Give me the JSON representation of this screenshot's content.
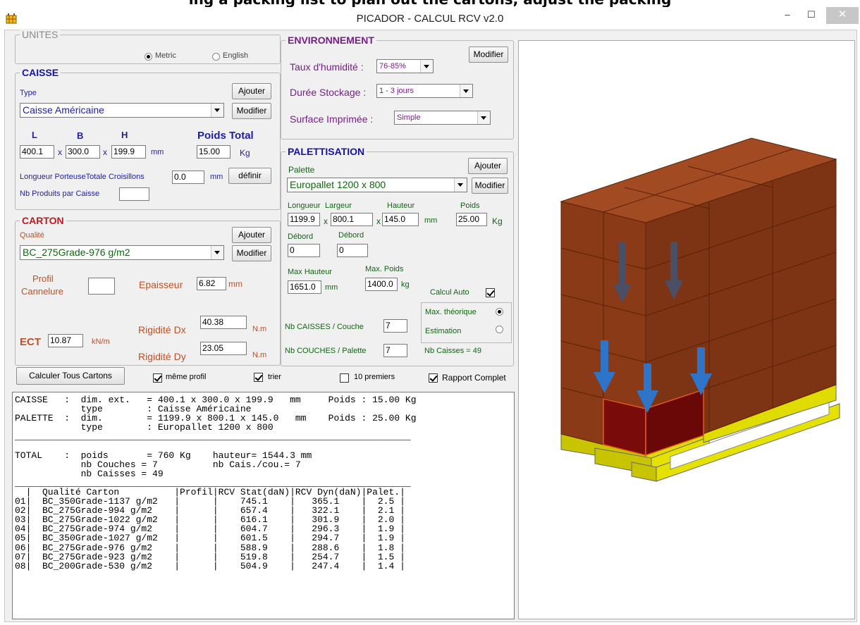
{
  "banner_text": "ing a packing list to plan out the cartons, adjust the packing",
  "window": {
    "title": "PICADOR - CALCUL RCV  v2.0",
    "min": "–",
    "max": "☐",
    "close": "✕"
  },
  "unites": {
    "title": "UNITES",
    "metric": "Metric",
    "english": "English",
    "selected": "metric"
  },
  "caisse": {
    "title": "CAISSE",
    "type_label": "Type",
    "type_value": "Caisse Américaine",
    "add": "Ajouter",
    "modify": "Modifier",
    "L": "L",
    "B": "B",
    "H": "H",
    "poids_total": "Poids Total",
    "L_val": "400.1",
    "B_val": "300.0",
    "H_val": "199.9",
    "x": "x",
    "mm": "mm",
    "poids_val": "15.00",
    "kg": "Kg",
    "croisillons_label": "Longueur PorteuseTotale Croisillons",
    "croisillons_val": "0.0",
    "croisillons_mm": "mm",
    "definir": "définir",
    "nb_produits_label": "Nb Produits par Caisse",
    "nb_produits_val": ""
  },
  "carton": {
    "title": "CARTON",
    "qualite_label": "Qualité",
    "qualite_value": "BC_275Grade-976 g/m2",
    "add": "Ajouter",
    "modify": "Modifier",
    "profil_label1": "Profil",
    "profil_label2": "Cannelure",
    "profil_val": "",
    "epaisseur_label": "Epaisseur",
    "epaisseur_val": "6.82",
    "epaisseur_unit": "mm",
    "ect_label": "ECT",
    "ect_val": "10.87",
    "ect_unit": "kN/m",
    "rig_dx_label": "Rigidité Dx",
    "rig_dx_val": "40.38",
    "rig_dy_label": "Rigidité Dy",
    "rig_dy_val": "23.05",
    "nm": "N.m"
  },
  "environnement": {
    "title": "ENVIRONNEMENT",
    "modify": "Modifier",
    "humidite_label": "Taux d'humidité :",
    "humidite_val": "76-85%",
    "duree_label": "Durée Stockage :",
    "duree_val": "1 - 3 jours",
    "surface_label": "Surface Imprimée :",
    "surface_val": "Simple"
  },
  "palettisation": {
    "title": "PALETTISATION",
    "palette_label": "Palette",
    "palette_value": "Europallet 1200 x 800",
    "add": "Ajouter",
    "modify": "Modifier",
    "longueur": "Longueur",
    "largeur": "Largeur",
    "hauteur": "Hauteur",
    "poids": "Poids",
    "longueur_val": "1199.9",
    "largeur_val": "800.1",
    "hauteur_val": "145.0",
    "poids_val": "25.00",
    "x": "x",
    "mm": "mm",
    "kg": "Kg",
    "debord1": "Débord",
    "debord2": "Débord",
    "debord1_val": "0",
    "debord2_val": "0",
    "max_hauteur_label": "Max Hauteur",
    "max_hauteur_val": "1651.0",
    "max_hauteur_unit": "mm",
    "max_poids_label": "Max. Poids",
    "max_poids_val": "1400.0",
    "max_poids_unit": "kg",
    "calcul_auto": "Calcul Auto",
    "nb_caisses_couche_label": "Nb CAISSES / Couche",
    "nb_caisses_couche_val": "7",
    "nb_couches_label": "Nb COUCHES / Palette",
    "nb_couches_val": "7",
    "max_theorique": "Max. théorique",
    "estimation": "Estimation",
    "nb_caisses_total": "Nb Caisses = 49"
  },
  "bottom": {
    "calculer": "Calculer Tous Cartons",
    "meme_profil": "même profil",
    "trier": "trier",
    "dix_premiers": "10 premiers",
    "rapport_complet": "Rapport Complet"
  },
  "report_lines": [
    "CAISSE   :  dim. ext.   = 400.1 x 300.0 x 199.9   mm     Poids : 15.00 Kg",
    "            type        : Caisse Américaine",
    "PALETTE  :  dim.        = 1199.9 x 800.1 x 145.0   mm    Poids : 25.00 Kg",
    "            type        : Europallet 1200 x 800",
    "________________________________________________________________________",
    "",
    "TOTAL    :  poids       = 760 Kg    hauteur= 1544.3 mm",
    "            nb Couches = 7          nb Cais./cou.= 7",
    "            nb Caisses = 49",
    "________________________________________________________________________",
    "  |  Qualité Carton          |Profil|RCV Stat(daN)|RCV Dyn(daN)|Palet.|",
    "01|  BC_350Grade-1137 g/m2   |      |    745.1    |   365.1    |  2.5 |",
    "02|  BC_275Grade-994 g/m2    |      |    657.4    |   322.1    |  2.1 |",
    "03|  BC_275Grade-1022 g/m2   |      |    616.1    |   301.9    |  2.0 |",
    "04|  BC_275Grade-974 g/m2    |      |    604.7    |   296.3    |  1.9 |",
    "05|  BC_350Grade-1027 g/m2   |      |    601.5    |   294.7    |  1.9 |",
    "06|  BC_275Grade-976 g/m2    |      |    588.9    |   288.6    |  1.8 |",
    "07|  BC_275Grade-923 g/m2    |      |    519.8    |   254.7    |  1.5 |",
    "08|  BC_200Grade-530 g/m2    |      |    504.9    |   247.4    |  1.4 |"
  ],
  "colors": {
    "box": "#a0522d",
    "box_top": "#9c4a22",
    "pallet": "#d8d400",
    "arrow_blue": "#2e74c8",
    "arrow_gray": "#4a4f66",
    "highlight": "#7a0b0b"
  }
}
